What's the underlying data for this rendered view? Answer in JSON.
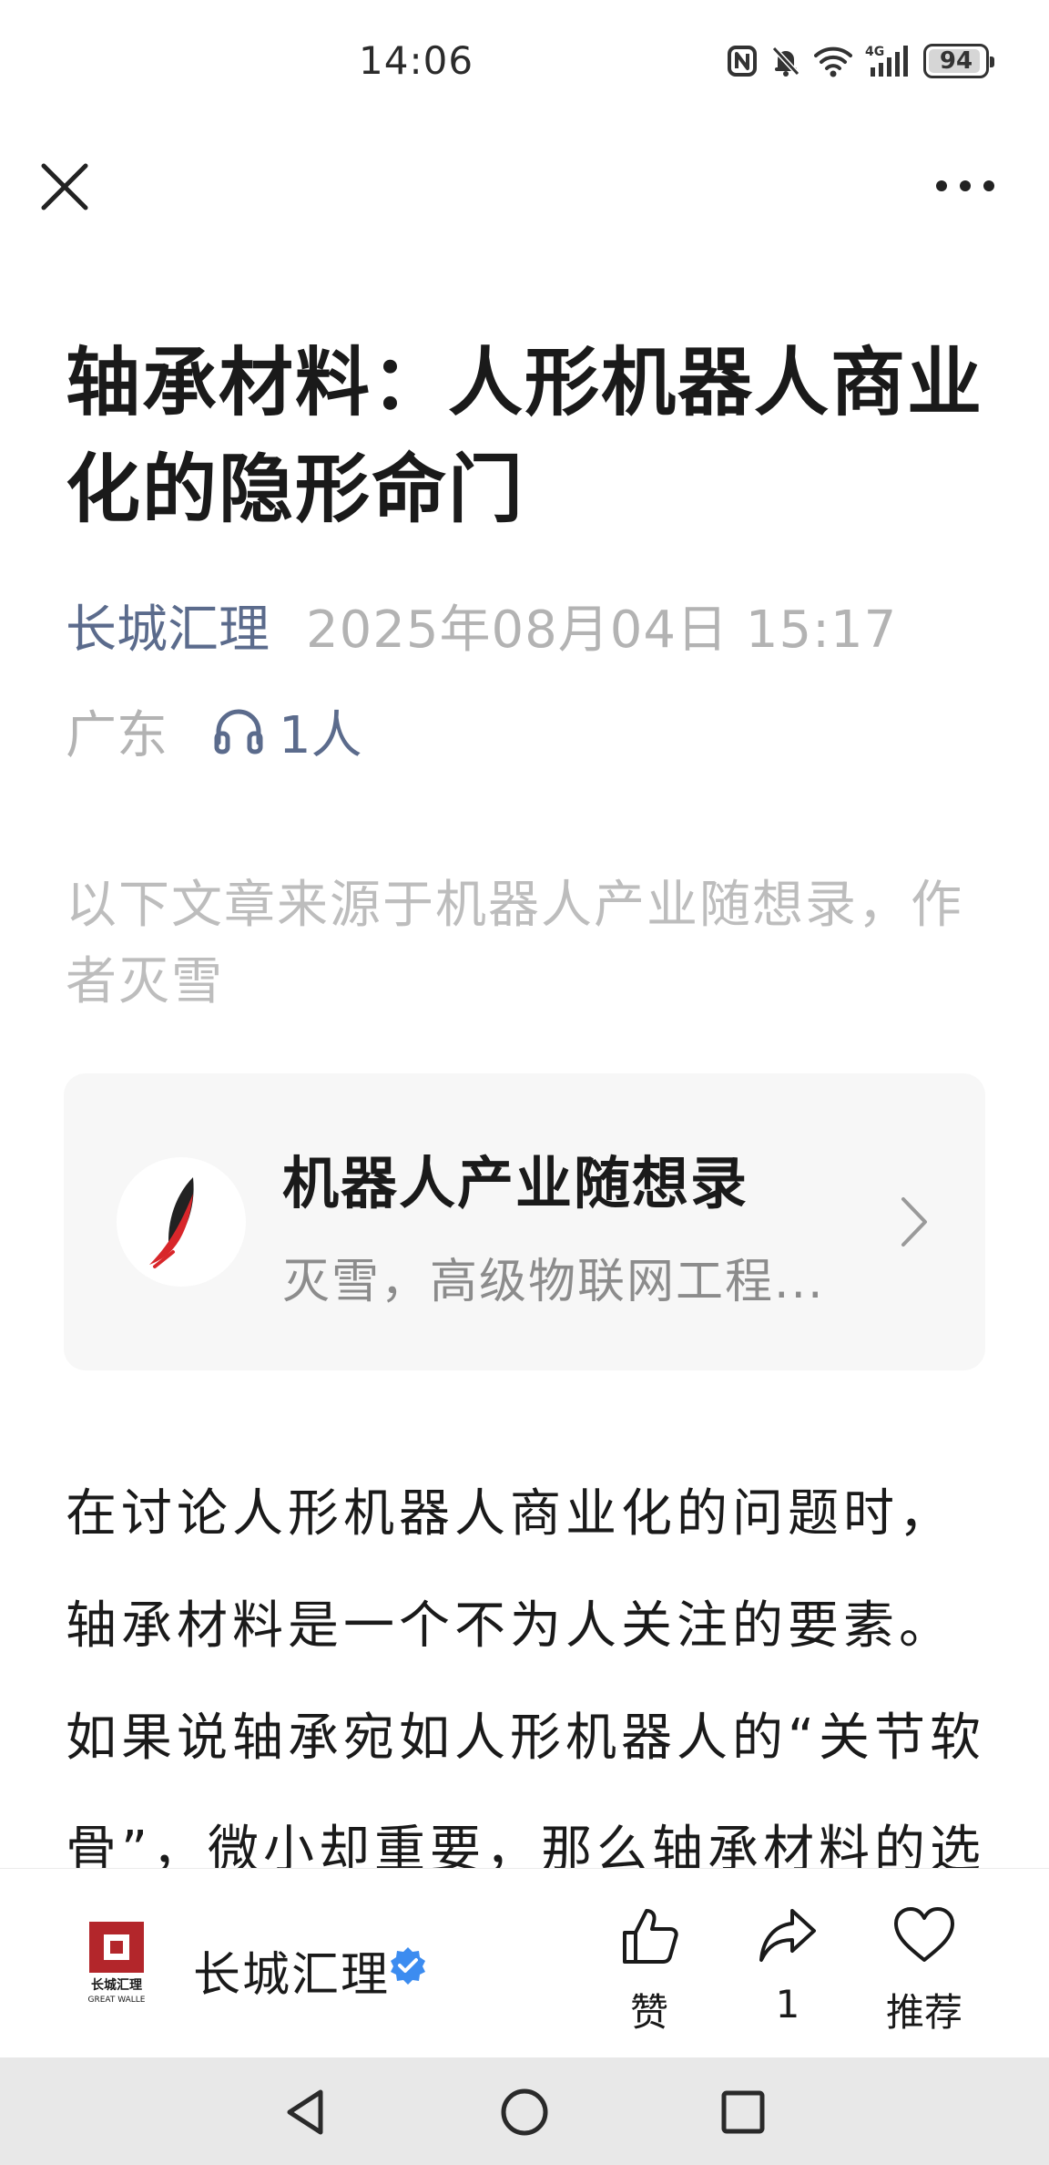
{
  "status_bar": {
    "time": "14:06",
    "network_label": "4G",
    "battery": "94",
    "battery_level": 0.94
  },
  "nav": {
    "close_icon": "close-icon",
    "more_icon": "more-icon"
  },
  "article": {
    "title": "轴承材料：人形机器人商业化的隐形命门",
    "author": "长城汇理",
    "date": "2025年08月04日 15:17",
    "location": "广东",
    "listen_count": "1人",
    "source_note": "以下文章来源于机器人产业随想录，作者灭雪",
    "body": [
      "在讨论人形机器人商业化的问题时，",
      "轴承材料是一个不为人关注的要素。",
      "如果说轴承宛如人形机器人的“关节软",
      "骨”，微小却重要，那么轴承材料的选"
    ]
  },
  "account_card": {
    "name": "机器人产业随想录",
    "description": "灭雪，高级物联网工程..."
  },
  "bottom_bar": {
    "account_name": "长城汇理",
    "logo_text": "长城汇理",
    "logo_subtext": "GREAT WALLE",
    "like_label": "赞",
    "share_count": "1",
    "recommend_label": "推荐",
    "brand_color": "#b3262b",
    "verified_color": "#3c8cf0"
  },
  "system_nav": {
    "back_icon": "back-triangle-icon",
    "home_icon": "home-circle-icon",
    "recents_icon": "recents-square-icon"
  }
}
